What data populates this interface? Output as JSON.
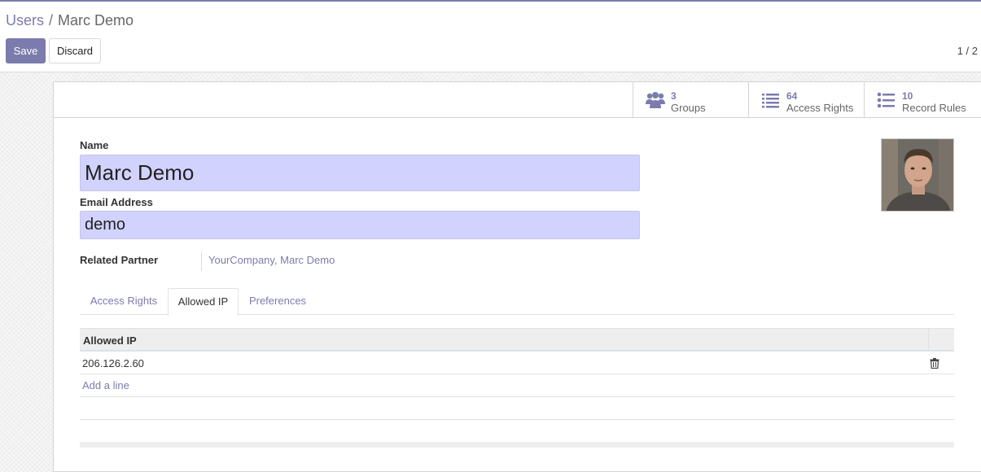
{
  "breadcrumb": {
    "parent": "Users",
    "separator": "/",
    "current": "Marc Demo"
  },
  "toolbar": {
    "save_label": "Save",
    "discard_label": "Discard"
  },
  "pager": {
    "value": "1 / 2"
  },
  "stat_buttons": [
    {
      "count": "3",
      "label": "Groups",
      "icon": "users-icon"
    },
    {
      "count": "64",
      "label": "Access Rights",
      "icon": "list-icon"
    },
    {
      "count": "10",
      "label": "Record Rules",
      "icon": "list-bullets-icon"
    }
  ],
  "form": {
    "name_label": "Name",
    "name_value": "Marc Demo",
    "email_label": "Email Address",
    "email_value": "demo",
    "partner_label": "Related Partner",
    "partner_value": "YourCompany, Marc Demo"
  },
  "tabs": [
    {
      "label": "Access Rights",
      "active": false
    },
    {
      "label": "Allowed IP",
      "active": true
    },
    {
      "label": "Preferences",
      "active": false
    }
  ],
  "allowed_ip": {
    "column_header": "Allowed IP",
    "rows": [
      "206.126.2.60"
    ],
    "add_line_label": "Add a line"
  },
  "colors": {
    "accent": "#7c7bad",
    "input_bg": "#d2d2ff"
  }
}
